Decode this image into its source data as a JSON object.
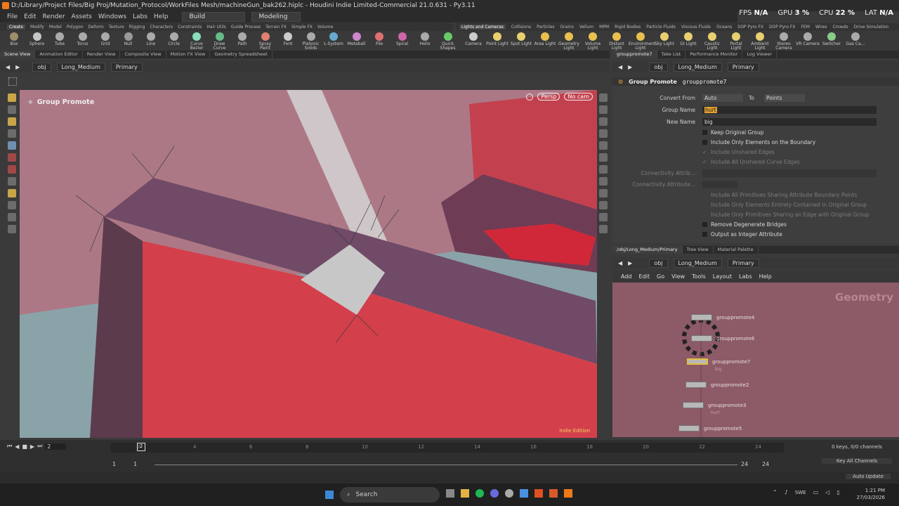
{
  "window": {
    "title": "D:/Library/Project Files/Big Proj/Mutation_Protocol/WorkFiles Mesh/machineGun_bak262.hiplc - Houdini Indie Limited-Commercial 21.0.631 - Py3.11"
  },
  "hud": {
    "fps_label": "FPS",
    "fps_value": "N/A",
    "gpu_label": "GPU",
    "gpu_value": "3 %",
    "cpu_label": "CPU",
    "cpu_value": "22 %",
    "lat_label": "LAT",
    "lat_value": "N/A"
  },
  "menu": {
    "items": [
      "File",
      "Edit",
      "Render",
      "Assets",
      "Windows",
      "Labs",
      "Help"
    ],
    "desktop": "Build",
    "context": "Modeling"
  },
  "shelf_tabs_left": [
    "Create",
    "Modify",
    "Model",
    "Polygon",
    "Deform",
    "Texture",
    "Rigging",
    "Characters",
    "Constraints",
    "Hair Utils",
    "Guide Process",
    "Terrain FX",
    "Simple FX",
    "Volume"
  ],
  "shelf_tabs_right": [
    "Lights and Cameras",
    "Collisions",
    "Particles",
    "Grains",
    "Vellum",
    "MPM",
    "Rigid Bodies",
    "Particle Fluids",
    "Viscous Fluids",
    "Oceans",
    "SOP Pyro FX",
    "DOP Pyro FX",
    "FEM",
    "Wires",
    "Crowds",
    "Drive Simulation"
  ],
  "tools_left": [
    "Box",
    "Sphere",
    "Tube",
    "Torus",
    "Grid",
    "Null",
    "Line",
    "Circle",
    "Curve Bezier",
    "Draw Curve",
    "Path",
    "Spray Paint",
    "Font",
    "Platonic Solids",
    "L-System",
    "Metaball",
    "File",
    "Spiral",
    "Helix",
    "Quick Shapes"
  ],
  "tools_right": [
    "Camera",
    "Point Light",
    "Spot Light",
    "Area Light",
    "Geometry Light",
    "Volume Light",
    "Distant Light",
    "Environment Light",
    "Sky Light",
    "GI Light",
    "Caustic Light",
    "Portal Light",
    "Ambient Light",
    "Stereo Camera",
    "VR Camera",
    "Switcher",
    "Gas Ca..."
  ],
  "pane_tabs_left": [
    "Scene View",
    "Animation Editor",
    "Render View",
    "Composite View",
    "Motion FX View",
    "Geometry Spreadsheet"
  ],
  "pane_tabs_right": [
    "grouppromote7",
    "Take List",
    "Performance Monitor",
    "Log Viewer"
  ],
  "path": {
    "root": "obj",
    "obj": "Long_Medium",
    "node": "Primary"
  },
  "viewport": {
    "state_label": "Group Promote",
    "persp": "Persp",
    "cam": "No cam",
    "edition": "Indie Edition"
  },
  "params": {
    "node_type": "Group Promote",
    "node_name": "grouppromote7",
    "convert_from_label": "Convert From",
    "convert_from_value": "Auto",
    "to_label": "To",
    "to_value": "Points",
    "group_name_label": "Group Name",
    "group_name_value": "hurt",
    "new_name_label": "New Name",
    "new_name_value": "big",
    "checks": [
      {
        "label": "Keep Original Group",
        "checked": false,
        "enabled": true
      },
      {
        "label": "Include Only Elements on the Boundary",
        "checked": false,
        "enabled": true
      },
      {
        "label": "Include Unshared Edges",
        "checked": true,
        "enabled": false
      },
      {
        "label": "Include All Unshared Curve Edges",
        "checked": true,
        "enabled": false
      }
    ],
    "conn_attr_label": "Connectivity Attrib...",
    "conn_attr2_label": "Connectivity Attribute...",
    "checks2": [
      {
        "label": "Include All Primitives Sharing Attribute Boundary Points",
        "checked": false,
        "enabled": false
      },
      {
        "label": "Include Only Elements Entirely Contained in Original Group",
        "checked": false,
        "enabled": false
      },
      {
        "label": "Include Only Primitives Sharing an Edge with Original Group",
        "checked": false,
        "enabled": false
      },
      {
        "label": "Remove Degenerate Bridges",
        "checked": false,
        "enabled": true
      },
      {
        "label": "Output as Integer Attribute",
        "checked": false,
        "enabled": true
      }
    ]
  },
  "network_tabs": [
    "/obj/Long_Medium/Primary",
    "Tree View",
    "Material Palette"
  ],
  "network_menu": [
    "Add",
    "Edit",
    "Go",
    "View",
    "Tools",
    "Layout",
    "Labs",
    "Help"
  ],
  "network": {
    "context_label": "Geometry",
    "nodes": [
      {
        "name": "grouppromote4",
        "sub": ""
      },
      {
        "name": "grouppromote6",
        "sub": ""
      },
      {
        "name": "grouppromote7",
        "sub": "big"
      },
      {
        "name": "grouppromote2",
        "sub": ""
      },
      {
        "name": "grouppromote3",
        "sub": "hurt"
      },
      {
        "name": "grouppromote5",
        "sub": ""
      }
    ]
  },
  "timeline": {
    "current_frame": "2",
    "start": "1",
    "start2": "1",
    "end": "24",
    "end2": "24",
    "ticks": [
      "2",
      "4",
      "6",
      "8",
      "10",
      "12",
      "14",
      "16",
      "18",
      "20",
      "22",
      "24"
    ],
    "keys_label": "0 keys, 0/0 channels",
    "key_all": "Key All Channels",
    "auto_update": "Auto Update"
  },
  "taskbar": {
    "search": "Search",
    "lang": "SWE",
    "time": "1:21 PM",
    "date": "27/03/2026"
  }
}
